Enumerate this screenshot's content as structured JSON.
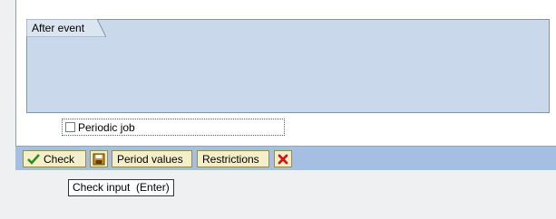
{
  "after_event": {
    "title": "After event"
  },
  "periodic_job": {
    "label": "Periodic job",
    "checked": false
  },
  "toolbar": {
    "check_label": "Check",
    "save_icon": "save-icon",
    "period_values_label": "Period values",
    "restrictions_label": "Restrictions",
    "cancel_icon": "cancel-icon"
  },
  "tooltip": {
    "text": "Check input  (Enter)"
  }
}
